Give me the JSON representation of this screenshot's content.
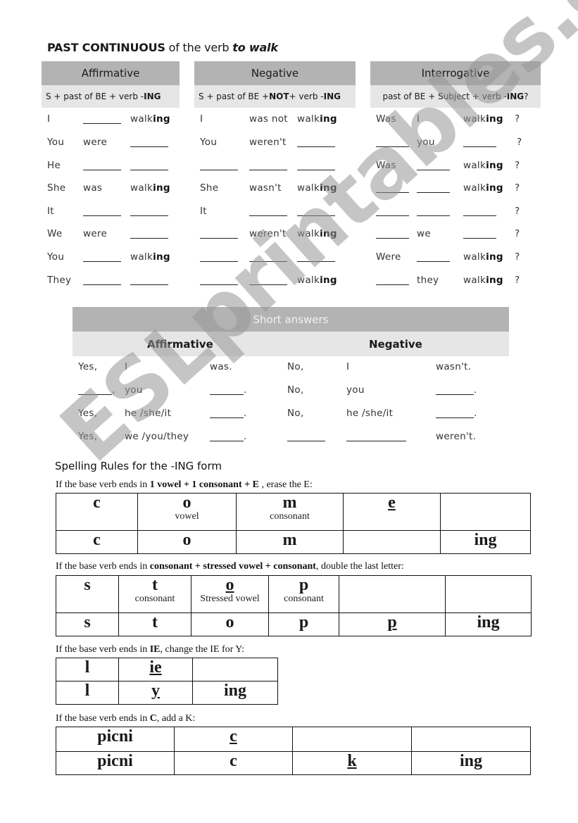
{
  "title": {
    "bold": "PAST CONTINUOUS",
    "middle": " of the verb ",
    "italic": "to walk"
  },
  "panels": [
    {
      "header": "Affirmative",
      "formula": [
        "S + past of BE + verb -",
        "ING",
        ""
      ]
    },
    {
      "header": "Negative",
      "formula": [
        "S + past of BE + ",
        "NOT",
        " + verb -",
        "ING"
      ]
    },
    {
      "header": "Interrogative",
      "formula": [
        "past of BE + Subject + verb -",
        "ING",
        " ?"
      ]
    }
  ],
  "walk_stem": "walk",
  "walk_suffix": "ing",
  "affirmative_rows": [
    [
      "I",
      "_",
      "walking"
    ],
    [
      "You",
      "were",
      "_"
    ],
    [
      "He",
      "_",
      "_"
    ],
    [
      "She",
      "was",
      "walking"
    ],
    [
      "It",
      "_",
      "_"
    ],
    [
      "We",
      "were",
      "_"
    ],
    [
      "You",
      "_",
      "walking"
    ],
    [
      "They",
      "_",
      "_"
    ]
  ],
  "negative_rows": [
    [
      "I",
      "was not",
      "walking"
    ],
    [
      "You",
      "weren't",
      "_"
    ],
    [
      "_",
      "_",
      "_"
    ],
    [
      "She",
      "wasn't",
      "walking"
    ],
    [
      "It",
      "_",
      "_"
    ],
    [
      "_",
      "weren't",
      "walking"
    ],
    [
      "_",
      "_",
      "_"
    ],
    [
      "_",
      "_",
      "walking"
    ]
  ],
  "interrogative_rows": [
    [
      "Was",
      "I",
      "walking",
      "?"
    ],
    [
      "_",
      "you",
      "_",
      "?"
    ],
    [
      "Was",
      "_",
      "walking",
      "?"
    ],
    [
      "_",
      "_",
      "walking",
      "?"
    ],
    [
      "_",
      "_",
      "_",
      "?"
    ],
    [
      "_",
      "we",
      "_",
      "?"
    ],
    [
      "Were",
      "_",
      "walking",
      "?"
    ],
    [
      "_",
      "they",
      "walking",
      "?"
    ]
  ],
  "short_answers": {
    "header": "Short answers",
    "affirmative_label": "Affirmative",
    "negative_label": "Negative",
    "rows": [
      [
        "Yes,",
        "I",
        "was.",
        "No,",
        "I",
        "wasn't."
      ],
      [
        "_,",
        "you",
        "_.",
        "No,",
        "you",
        "_."
      ],
      [
        "Yes,",
        "he /she/it",
        "_.",
        "No,",
        "he /she/it",
        "_."
      ],
      [
        "Yes,",
        "we /you/they",
        "_.",
        "_",
        "_",
        "weren't."
      ]
    ]
  },
  "spelling": {
    "title": "Spelling Rules for the -ING form",
    "rules": [
      {
        "text": [
          "If the base verb ends in ",
          "1 vowel + 1 consonant + E",
          " , erase the E:"
        ],
        "row1": [
          {
            "t": "c"
          },
          {
            "t": "o",
            "s": "vowel"
          },
          {
            "t": "m",
            "s": "consonant"
          },
          {
            "t": "e",
            "u": true
          },
          {
            "t": ""
          }
        ],
        "row2": [
          {
            "t": "c"
          },
          {
            "t": "o"
          },
          {
            "t": "m"
          },
          {
            "t": ""
          },
          {
            "t": "ing"
          }
        ]
      },
      {
        "text": [
          "If the base verb ends in ",
          "consonant + stressed vowel + consonant",
          ", double the last letter:"
        ],
        "row1": [
          {
            "t": "s"
          },
          {
            "t": "t",
            "s": "consonant"
          },
          {
            "t": "o",
            "s": "Stressed vowel",
            "u": true
          },
          {
            "t": "p",
            "s": "consonant"
          },
          {
            "t": ""
          },
          {
            "t": ""
          }
        ],
        "row2": [
          {
            "t": "s"
          },
          {
            "t": "t"
          },
          {
            "t": "o"
          },
          {
            "t": "p"
          },
          {
            "t": "p",
            "u": true
          },
          {
            "t": "ing"
          }
        ]
      },
      {
        "text": [
          "If the base verb ends in ",
          "IE",
          ", change the IE for Y:"
        ],
        "row1": [
          {
            "t": "l"
          },
          {
            "t": "ie",
            "u": true
          },
          {
            "t": ""
          }
        ],
        "row2": [
          {
            "t": "l"
          },
          {
            "t": "y",
            "u": true
          },
          {
            "t": "ing"
          }
        ]
      },
      {
        "text": [
          "If the base verb ends in ",
          "C",
          ", add a K:"
        ],
        "row1": [
          {
            "t": "picni"
          },
          {
            "t": "c",
            "u": true
          },
          {
            "t": ""
          },
          {
            "t": ""
          }
        ],
        "row2": [
          {
            "t": "picni"
          },
          {
            "t": "c"
          },
          {
            "t": "k",
            "u": true
          },
          {
            "t": "ing"
          }
        ]
      }
    ]
  },
  "watermark": "ESLprintables.com"
}
